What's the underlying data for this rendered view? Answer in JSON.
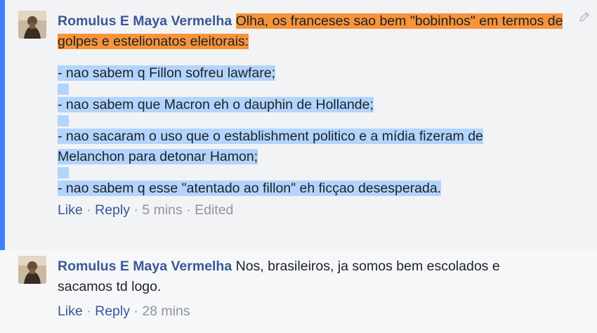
{
  "comments": [
    {
      "author": "Romulus E Maya Vermelha",
      "highlighted_text": "Olha, os franceses sao bem \"bobinhos\" em termos de golpes e estelionatos eleitorais:",
      "lines": [
        "- nao sabem q Fillon sofreu lawfare;",
        "- nao sabem que Macron eh o dauphin de Hollande;",
        "- nao sacaram o uso que o establishment politico e a mídia fizeram de Melanchon para detonar Hamon;",
        "- nao sabem q esse \"atentado ao fillon\" eh ficçao desesperada."
      ],
      "like": "Like",
      "reply": "Reply",
      "time": "5 mins",
      "edited": "Edited",
      "sep": "·"
    },
    {
      "author": "Romulus E Maya Vermelha",
      "text": "Nos, brasileiros, ja somos bem escolados e sacamos td logo.",
      "like": "Like",
      "reply": "Reply",
      "time": "28 mins",
      "sep": "·"
    }
  ],
  "icons": {
    "edit": "pencil-icon",
    "avatar": "profile-photo"
  },
  "colors": {
    "author": "#385898",
    "orange_highlight": "#f7943a",
    "selection": "#b3d4fc",
    "accent": "#4080ff"
  }
}
